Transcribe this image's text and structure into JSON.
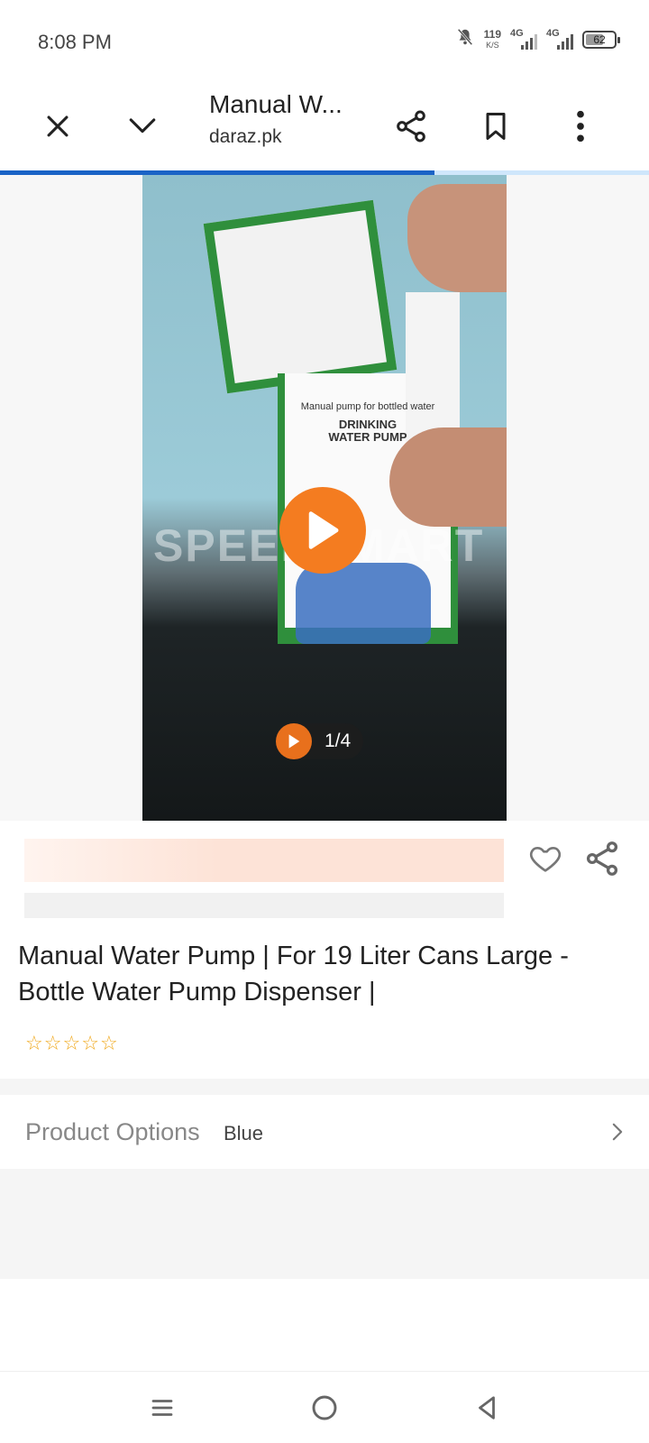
{
  "status_bar": {
    "time": "8:08 PM",
    "speed_value": "119",
    "speed_unit": "K/S",
    "net1_label": "4G",
    "net2_label": "4G",
    "battery": "62",
    "battery_level_percent": 62,
    "icons": [
      "mute-bell-icon",
      "signal-icon",
      "signal-icon",
      "battery-icon"
    ]
  },
  "toolbar": {
    "title": "Manual W...",
    "domain": "daraz.pk",
    "icons": [
      "close-icon",
      "chevron-down-icon",
      "share-icon",
      "bookmark-icon",
      "more-vert-icon"
    ],
    "load_progress_percent": 67
  },
  "media": {
    "watermark": "SPEEDSMART",
    "box_text_1": "Manual pump for bottled water",
    "box_text_2": "DRINKING",
    "box_text_3": "WATER PUMP",
    "counter": "1/4"
  },
  "product": {
    "title": "Manual Water Pump | For 19 Liter Cans Large - Bottle Water Pump Dispenser |",
    "rating_stars": 0,
    "star_glyphs": [
      "☆",
      "☆",
      "☆",
      "☆",
      "☆"
    ]
  },
  "options": {
    "label": "Product Options",
    "value": "Blue"
  },
  "colors": {
    "accent_orange": "#f47c20",
    "progress_blue": "#1a63c6",
    "star": "#f0a81b"
  }
}
